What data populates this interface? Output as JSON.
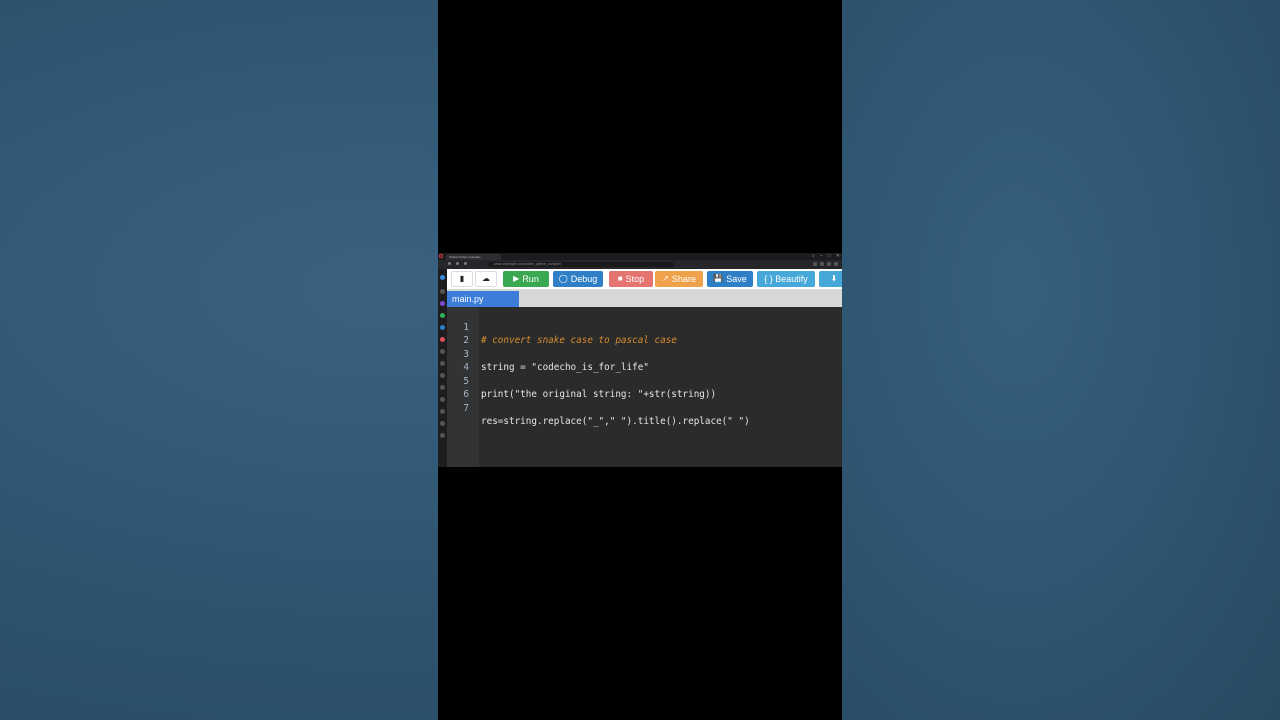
{
  "browser": {
    "tab_title": "Online Python Compiler",
    "url": "www.onlinegdb.com/online_python_compiler"
  },
  "toolbar": {
    "buttons": [
      {
        "label": "",
        "icon": "new-file-icon",
        "color": "#ffffff"
      },
      {
        "label": "",
        "icon": "upload-icon",
        "color": "#ffffff"
      },
      {
        "label": "Run",
        "icon": "play-icon",
        "color": "#3aa851"
      },
      {
        "label": "Debug",
        "icon": "debug-icon",
        "color": "#2f7fc6"
      },
      {
        "label": "Stop",
        "icon": "stop-icon",
        "color": "#e5736f"
      },
      {
        "label": "Share",
        "icon": "share-icon",
        "color": "#f0a24a"
      },
      {
        "label": "Save",
        "icon": "save-icon",
        "color": "#2f7fc6"
      },
      {
        "label": "{ } Beautify",
        "icon": "",
        "color": "#45a8d8"
      },
      {
        "label": "",
        "icon": "download-icon",
        "color": "#45a8d8"
      }
    ]
  },
  "file_tab": "main.py",
  "editor": {
    "line_numbers": [
      "1",
      "2",
      "3",
      "4",
      "5",
      "6",
      "7"
    ],
    "lines": [
      "# convert snake case to pascal case",
      "",
      "string = \"codecho_is_for_life\"",
      "",
      "print(\"the original string: \"+str(string))",
      "",
      "res=string.replace(\"_\",\" \").title().replace(\" \")"
    ]
  },
  "colors": {
    "editor_bg": "#2b2b2b",
    "comment": "#d58b2d",
    "string": "#d8c38a",
    "tab_active": "#3b7dd8"
  }
}
